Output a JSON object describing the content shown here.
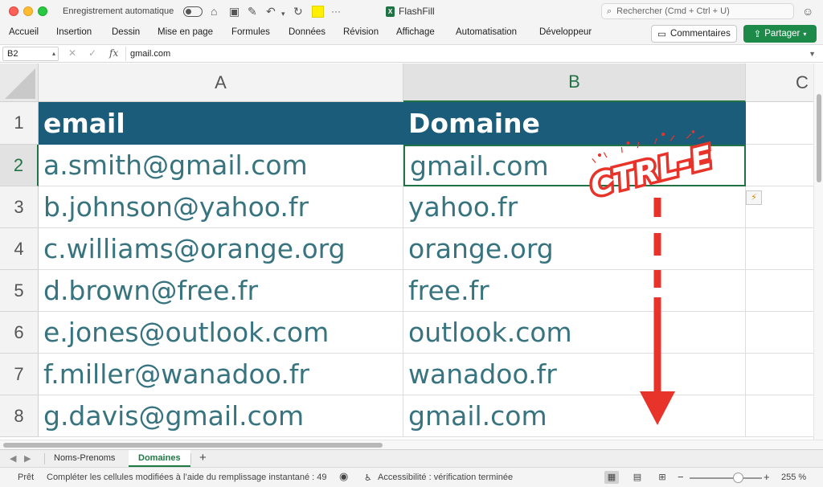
{
  "titlebar": {
    "autosave_label": "Enregistrement automatique",
    "doc_title": "FlashFill",
    "search_placeholder": "Rechercher (Cmd + Ctrl + U)",
    "more": "···"
  },
  "ribbon": {
    "tabs": [
      "Accueil",
      "Insertion",
      "Dessin",
      "Mise en page",
      "Formules",
      "Données",
      "Révision",
      "Affichage",
      "Automatisation",
      "Développeur"
    ],
    "comments_label": "Commentaires",
    "share_label": "Partager"
  },
  "formula_bar": {
    "name_box": "B2",
    "fx": "fx",
    "content": "gmail.com"
  },
  "columns": [
    "A",
    "B",
    "C"
  ],
  "selected_column": "B",
  "rows": [
    {
      "num": "1",
      "a": "email",
      "b": "Domaine"
    },
    {
      "num": "2",
      "a": "a.smith@gmail.com",
      "b": "gmail.com"
    },
    {
      "num": "3",
      "a": "b.johnson@yahoo.fr",
      "b": "yahoo.fr"
    },
    {
      "num": "4",
      "a": "c.williams@orange.org",
      "b": "orange.org"
    },
    {
      "num": "5",
      "a": "d.brown@free.fr",
      "b": "free.fr"
    },
    {
      "num": "6",
      "a": "e.jones@outlook.com",
      "b": "outlook.com"
    },
    {
      "num": "7",
      "a": "f.miller@wanadoo.fr",
      "b": "wanadoo.fr"
    },
    {
      "num": "8",
      "a": "g.davis@gmail.com",
      "b": "gmail.com"
    }
  ],
  "overlay": {
    "stamp_text": "CTRL-E",
    "colors": {
      "stamp": "#e8332a",
      "arrow": "#e8332a"
    }
  },
  "sheets": {
    "tabs": [
      "Noms-Prenoms",
      "Domaines"
    ],
    "active": "Domaines",
    "add": "+"
  },
  "statusbar": {
    "ready": "Prêt",
    "message": "Compléter les cellules modifiées à l’aide du remplissage instantané : 49",
    "accessibility": "Accessibilité : vérification terminée",
    "zoom_minus": "−",
    "zoom_plus": "+",
    "zoom": "255 %"
  },
  "colors": {
    "header_fill": "#1b5c7a",
    "cell_text": "#38747f",
    "accent": "#217346",
    "share": "#1e8a4a"
  }
}
